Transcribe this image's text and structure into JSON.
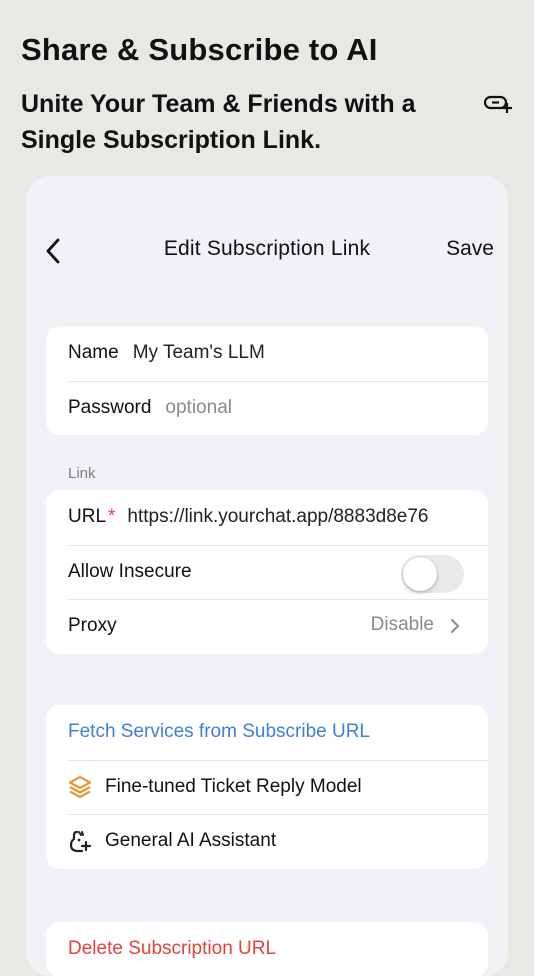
{
  "promo": {
    "title": "Share & Subscribe to AI",
    "subtitle": "Unite Your Team & Friends with a Single Subscription Link.",
    "link_icon": "link-add-icon"
  },
  "nav": {
    "back_icon": "chevron-left-icon",
    "title": "Edit Subscription Link",
    "save": "Save"
  },
  "form": {
    "name_label": "Name",
    "name_value": "My Team's LLM",
    "password_label": "Password",
    "password_placeholder": "optional"
  },
  "link_section": {
    "header": "Link",
    "url_label": "URL",
    "url_required": "*",
    "url_value": "https://link.yourchat.app/8883d8e76",
    "allow_insecure_label": "Allow Insecure",
    "allow_insecure_on": false,
    "proxy_label": "Proxy",
    "proxy_value": "Disable"
  },
  "services": {
    "fetch_label": "Fetch Services from Subscribe URL",
    "items": [
      {
        "label": "Fine-tuned Ticket Reply Model",
        "icon": "stack-model-icon"
      },
      {
        "label": "General AI Assistant",
        "icon": "ai-assistant-icon"
      }
    ]
  },
  "danger": {
    "delete_label": "Delete Subscription URL"
  },
  "colors": {
    "accent": "#3f7fdc",
    "danger": "#e0443a",
    "model_icon": "#e8943a"
  }
}
